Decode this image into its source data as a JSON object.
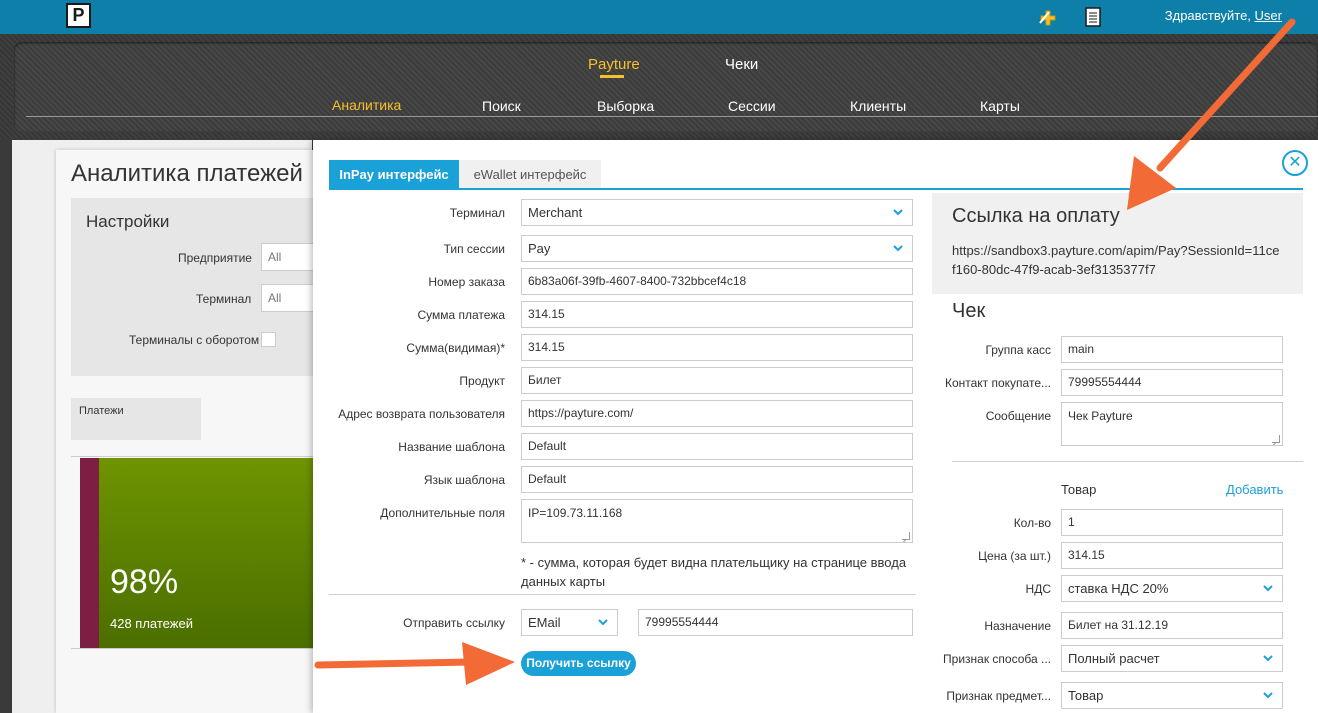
{
  "header": {
    "logo_text": "P",
    "greeting": "Здравствуйте,",
    "user": "User",
    "icons": [
      "puzzle-plus-icon",
      "document-icon"
    ]
  },
  "nav": {
    "top": [
      {
        "label": "Payture",
        "active": true
      },
      {
        "label": "Чеки",
        "active": false
      }
    ],
    "sub": [
      {
        "label": "Аналитика",
        "active": true
      },
      {
        "label": "Поиск",
        "active": false
      },
      {
        "label": "Выборка",
        "active": false
      },
      {
        "label": "Сессии",
        "active": false
      },
      {
        "label": "Клиенты",
        "active": false
      },
      {
        "label": "Карты",
        "active": false
      }
    ]
  },
  "background_page": {
    "title": "Аналитика платежей",
    "settings": {
      "title": "Настройки",
      "enterprise_label": "Предприятие",
      "enterprise_value": "All",
      "terminal_label": "Терминал",
      "terminal_value": "All",
      "turnover_label": "Терминалы с оборотом"
    },
    "payments_label": "Платежи",
    "tile": {
      "percent": "98%",
      "count": "428 платежей"
    }
  },
  "modal": {
    "tabs": [
      {
        "label": "InPay интерфейс",
        "active": true
      },
      {
        "label": "eWallet интерфейс",
        "active": false
      }
    ],
    "form": {
      "terminal_label": "Терминал",
      "terminal_value": "Merchant",
      "session_type_label": "Тип сессии",
      "session_type_value": "Pay",
      "order_number_label": "Номер заказа",
      "order_number_value": "6b83a06f-39fb-4607-8400-732bbcef4c18",
      "amount_label": "Сумма платежа",
      "amount_value": "314.15",
      "visible_amount_label": "Сумма(видимая)*",
      "visible_amount_value": "314.15",
      "product_label": "Продукт",
      "product_value": "Билет",
      "return_url_label": "Адрес возврата пользователя",
      "return_url_value": "https://payture.com/",
      "template_name_label": "Название шаблона",
      "template_name_value": "Default",
      "template_lang_label": "Язык шаблона",
      "template_lang_value": "Default",
      "extra_fields_label": "Дополнительные поля",
      "extra_fields_value": "IP=109.73.11.168",
      "note": "* - сумма, которая будет видна плательщику на странице ввода данных карты",
      "send_link_label": "Отправить ссылку",
      "send_method_value": "EMail",
      "send_target_value": "79995554444",
      "get_link_button": "Получить ссылку"
    },
    "payment_link": {
      "title": "Ссылка на оплату",
      "url": "https://sandbox3.payture.com/apim/Pay?SessionId=11cef160-80dc-47f9-acab-3ef3135377f7"
    },
    "receipt": {
      "title": "Чек",
      "cash_group_label": "Группа касс",
      "cash_group_value": "main",
      "buyer_contact_label": "Контакт покупате...",
      "buyer_contact_value": "79995554444",
      "message_label": "Сообщение",
      "message_value": "Чек Payture",
      "goods_label": "Товар",
      "add_label": "Добавить",
      "qty_label": "Кол-во",
      "qty_value": "1",
      "price_label": "Цена (за шт.)",
      "price_value": "314.15",
      "vat_label": "НДС",
      "vat_value": "ставка НДС 20%",
      "purpose_label": "Назначение",
      "purpose_value": "Билет на 31.12.19",
      "payment_method_label": "Признак способа ...",
      "payment_method_value": "Полный расчет",
      "subject_label": "Признак предмет...",
      "subject_value": "Товар"
    }
  },
  "colors": {
    "topbar": "#0e7fa9",
    "accent": "#1aa1d8",
    "active_nav": "#f6c12a",
    "arrow": "#f26a35",
    "tile_green": "#6e9400",
    "tile_stripe": "#7c1f43"
  }
}
